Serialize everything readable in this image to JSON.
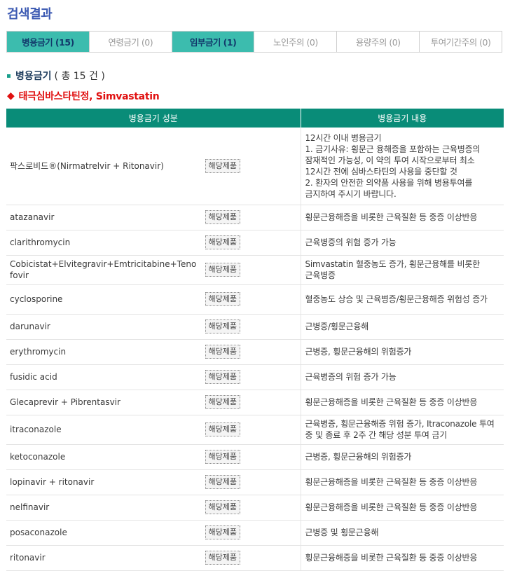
{
  "page": {
    "title": "검색결과"
  },
  "tabs": [
    {
      "label": "병용금기 (15)",
      "active": true
    },
    {
      "label": "연령금기 (0)",
      "active": false
    },
    {
      "label": "임부금기 (1)",
      "active": true
    },
    {
      "label": "노인주의 (0)",
      "active": false
    },
    {
      "label": "용량주의 (0)",
      "active": false
    },
    {
      "label": "투여기간주의 (0)",
      "active": false
    }
  ],
  "section": {
    "title": "병용금기",
    "count_text": "( 총 15 건 )"
  },
  "drug": {
    "name": "태극심바스타틴정, Simvastatin"
  },
  "table": {
    "headers": [
      "병용금기 성분",
      "병용금기 내용"
    ],
    "button_label": "해당제품",
    "rows": [
      {
        "ingredient": "팍스로비드®(Nirmatrelvir + Ritonavir)",
        "content": [
          "12시간 이내 병용금기",
          "1. 금기사유: 횡문근 융해증을 포함하는 근육병증의 잠재적인 가능성, 이 약의 투여 시작으로부터 최소 12시간 전에 심바스타틴의 사용을 중단할 것",
          "2. 환자의 안전한 의약품 사용을 위해 병용투여를 금지하여 주시기 바랍니다."
        ]
      },
      {
        "ingredient": "atazanavir",
        "content": [
          "횡문근융해증을 비롯한 근육질환 등 중증 이상반응"
        ]
      },
      {
        "ingredient": "clarithromycin",
        "content": [
          "근육병증의 위험 증가 가능"
        ]
      },
      {
        "ingredient": "Cobicistat+Elvitegravir+Emtricitabine+Tenofovir",
        "content": [
          "Simvastatin 혈중농도 증가, 횡문근융해를 비롯한 근육병증"
        ]
      },
      {
        "ingredient": "cyclosporine",
        "content": [
          "혈중농도 상승 및 근육병증/횡문근융해증 위험성 증가"
        ]
      },
      {
        "ingredient": "darunavir",
        "content": [
          "근병증/횡문근융해"
        ]
      },
      {
        "ingredient": "erythromycin",
        "content": [
          "근병증, 횡문근융해의 위험증가"
        ]
      },
      {
        "ingredient": "fusidic acid",
        "content": [
          "근육병증의 위험 증가 가능"
        ]
      },
      {
        "ingredient": "Glecaprevir + Pibrentasvir",
        "content": [
          "횡문근융해증을 비롯한 근육질환 등 중증 이상반응"
        ]
      },
      {
        "ingredient": "itraconazole",
        "content": [
          "근육병증, 횡문근융해증 위험 증가, Itraconazole 투여 중 및 종료 후 2주 간 해당 성분 투여 금기"
        ]
      },
      {
        "ingredient": "ketoconazole",
        "content": [
          "근병증, 횡문근융해의 위험증가"
        ]
      },
      {
        "ingredient": "lopinavir + ritonavir",
        "content": [
          "횡문근융해증을 비롯한 근육질환 등 중증 이상반응"
        ]
      },
      {
        "ingredient": "nelfinavir",
        "content": [
          "횡문근융해증을 비롯한 근육질환 등 중증 이상반응"
        ]
      },
      {
        "ingredient": "posaconazole",
        "content": [
          "근병증 및 횡문근융해"
        ]
      },
      {
        "ingredient": "ritonavir",
        "content": [
          "횡문근융해증을 비롯한 근육질환 등 중증 이상반응"
        ]
      }
    ]
  },
  "colors": {
    "accent_tab": "#3cbcae",
    "header_green": "#098c78",
    "title_blue": "#3b59b2",
    "drug_red": "#e01010"
  }
}
